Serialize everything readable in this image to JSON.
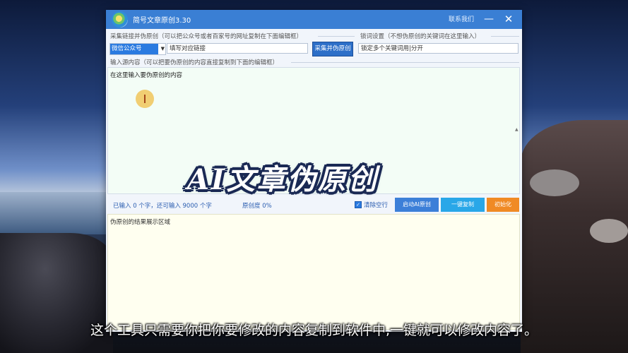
{
  "window": {
    "title": "简号文章原创3.30",
    "contact": "联系我们",
    "minimize": "—",
    "close": "✕"
  },
  "collect": {
    "label": "采集链接并伪原创（可以把公众号或者百家号的网址复制在下面编辑框）",
    "platform_value": "微信公众号",
    "url_placeholder": "填写对应链接",
    "button": "采集并伪原创"
  },
  "lock_words": {
    "label": "锁词设置（不想伪原创的关键词在这里输入）",
    "value": "锁定多个关键词用|分开"
  },
  "input": {
    "label": "输入源内容（可以把要伪原创的内容直接复制到下面的编辑框）",
    "placeholder": "在这里输入要伪原创的内容"
  },
  "status": {
    "count_text": "已输入 0 个字，还可输入 9000 个字",
    "originality_text": "原创度 0%",
    "clear_blank_label": "清除空行",
    "clear_blank_checked": true
  },
  "actions": {
    "start": "启动AI原创",
    "copy": "一键复制",
    "reset": "初始化"
  },
  "result": {
    "label": "伪原创的结果展示区域"
  },
  "overlay": {
    "title": "AI文章伪原创"
  },
  "subtitle": "这个工具只需要你把你要修改的内容复制到软件中,一键就可以修改内容了。",
  "colors": {
    "titlebar": "#3a7fd4",
    "start_button": "#3c7fd8",
    "copy_button": "#29a7e8",
    "reset_button": "#f08a24"
  }
}
